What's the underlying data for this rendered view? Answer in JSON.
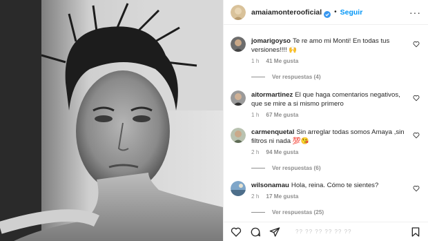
{
  "post": {
    "username": "amaiamonterooficial",
    "separator": "•",
    "follow_label": "Seguir",
    "more_label": "···"
  },
  "comments": [
    {
      "user": "jomarigoyso",
      "text": "Te re amo mi Monti! En todas tus versiones!!!! 🙌",
      "time": "1 h",
      "likes": "41 Me gusta",
      "replies": "Ver respuestas (4)"
    },
    {
      "user": "aitormartinez",
      "text": "El que haga comentarios negativos, que se mire a si mismo primero",
      "time": "1 h",
      "likes": "67 Me gusta",
      "replies": ""
    },
    {
      "user": "carmenquetal",
      "text": "Sin arreglar todas somos Amaya ,sin filtros ni nada 💯😘",
      "time": "2 h",
      "likes": "94 Me gusta",
      "replies": "Ver respuestas (6)"
    },
    {
      "user": "wilsonamau",
      "text": "Hola, reina. Cómo te sientes?",
      "time": "2 h",
      "likes": "17 Me gusta",
      "replies": "Ver respuestas (25)"
    }
  ],
  "footer": {
    "liked_by_teaser": "?? ?? ?? ?? ?? ??"
  },
  "icons": {
    "header": [
      "avatar",
      "verified-badge-icon",
      "more-options-icon"
    ],
    "actions": [
      "heart-icon",
      "comment-icon",
      "share-icon",
      "bookmark-icon"
    ]
  },
  "colors": {
    "follow_blue": "#0095f6",
    "meta_gray": "#8e8e8e",
    "border": "#efefef"
  }
}
